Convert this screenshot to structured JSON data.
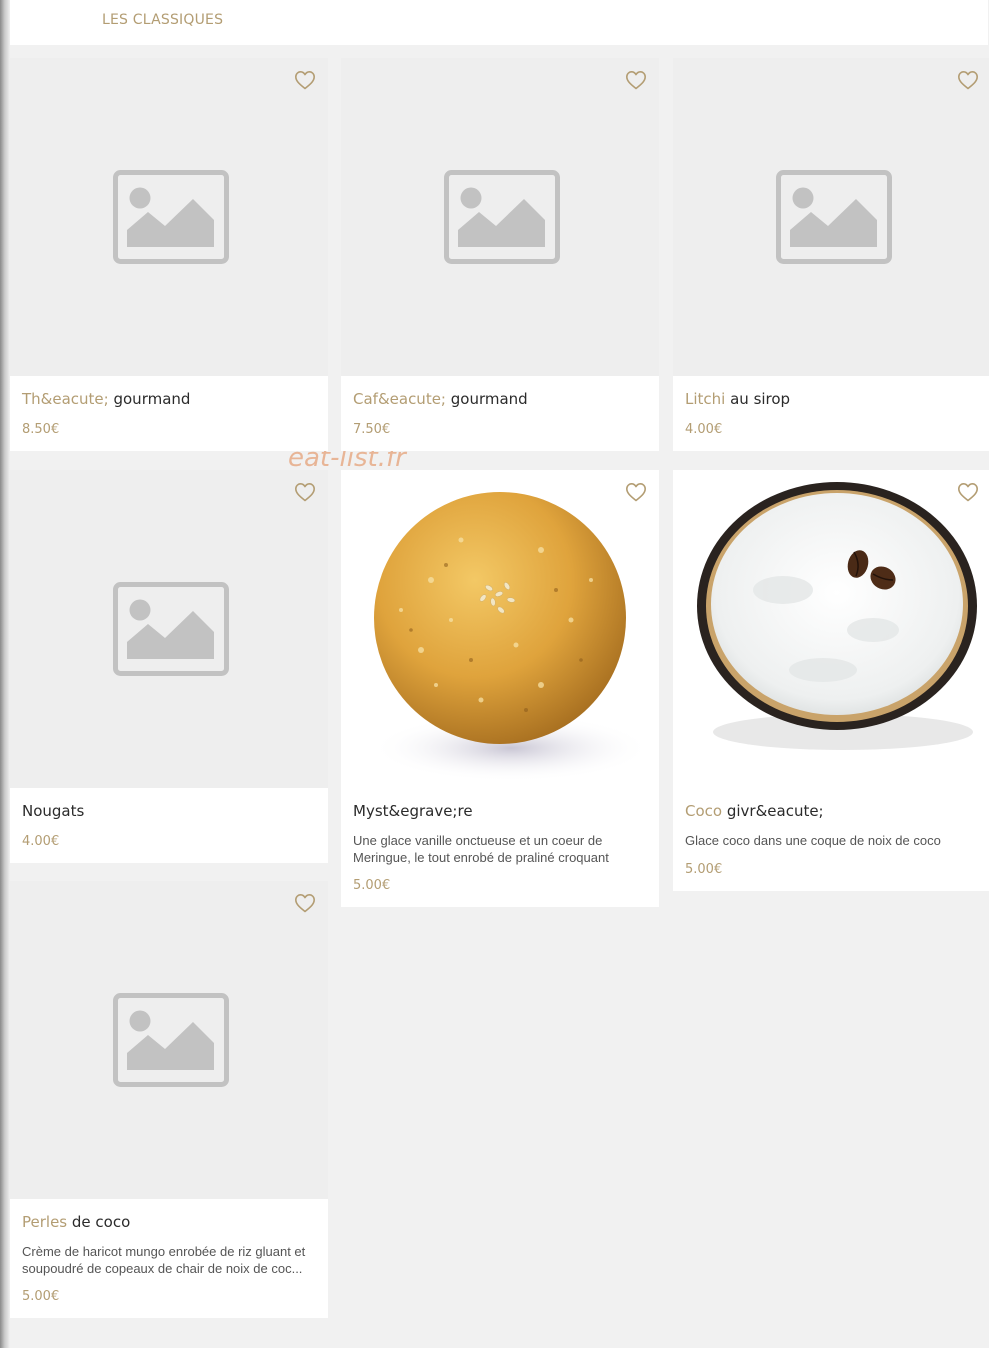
{
  "header": {
    "tab_label": "LES CLASSIQUES"
  },
  "watermark": "eat-list.fr",
  "colors": {
    "accent": "#b39d73",
    "placeholder_bg": "#eeeeee",
    "page_bg": "#f1f1f1"
  },
  "products": [
    {
      "title_accent": "Th&eacute;",
      "title_rest": " gourmand",
      "price": "8.50€",
      "image": "placeholder-icon"
    },
    {
      "title_accent": "Caf&eacute;",
      "title_rest": " gourmand",
      "price": "7.50€",
      "image": "placeholder-icon"
    },
    {
      "title_accent": "Litchi",
      "title_rest": " au sirop",
      "price": "4.00€",
      "image": "placeholder-icon"
    },
    {
      "title_accent": "",
      "title_rest": "Nougats",
      "price": "4.00€",
      "image": "placeholder-icon"
    },
    {
      "title_accent": "",
      "title_rest": "Myst&egrave;re",
      "description": "Une glace vanille onctueuse et un coeur de Meringue, le tout enrobé de praliné croquant",
      "price": "5.00€",
      "image": "praline-ball-photo"
    },
    {
      "title_accent": "Coco",
      "title_rest": " givr&eacute;",
      "description": "Glace coco dans une coque de noix de coco",
      "price": "5.00€",
      "image": "coconut-shell-photo"
    },
    {
      "title_accent": "Perles",
      "title_rest": " de coco",
      "description": "Crème de haricot mungo enrobée de riz gluant et soupoudré de copeaux de chair de noix de coc...",
      "price": "5.00€",
      "image": "placeholder-icon"
    }
  ]
}
